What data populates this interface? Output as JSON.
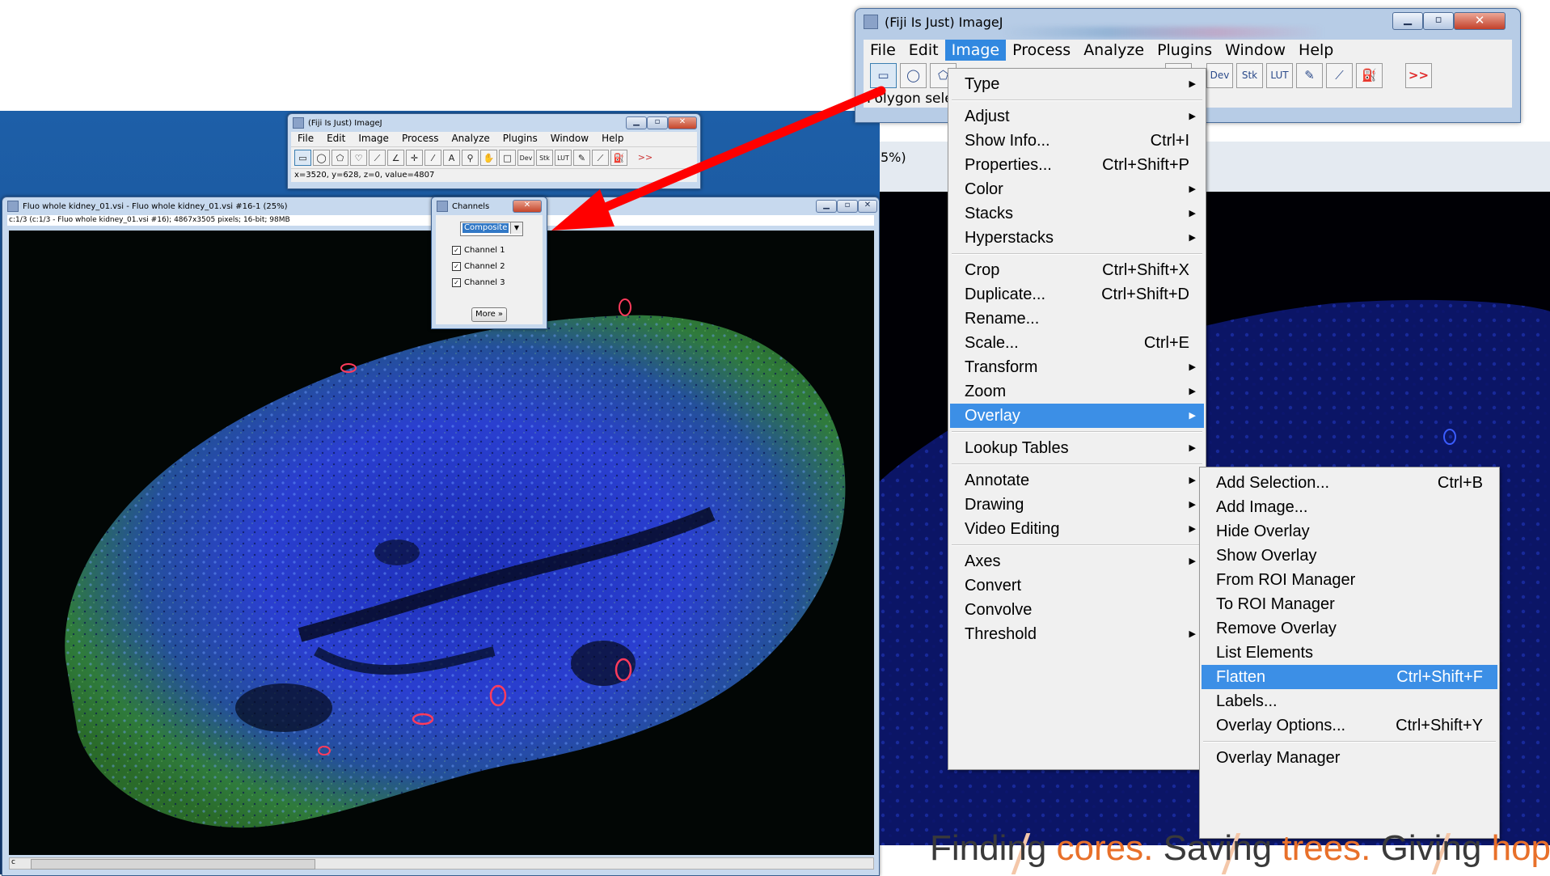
{
  "small_ij": {
    "title": "(Fiji Is Just) ImageJ",
    "menu": [
      "File",
      "Edit",
      "Image",
      "Process",
      "Analyze",
      "Plugins",
      "Window",
      "Help"
    ],
    "status": "x=3520, y=628, z=0, value=4807"
  },
  "image_window": {
    "title": "Fluo whole kidney_01.vsi - Fluo whole kidney_01.vsi #16-1 (25%)",
    "info": "c:1/3 (c:1/3 - Fluo whole kidney_01.vsi #16); 4867x3505 pixels; 16-bit; 98MB",
    "scroll_label": "c"
  },
  "channels": {
    "title": "Channels",
    "mode": "Composite",
    "items": [
      {
        "label": "Channel 1",
        "checked": true
      },
      {
        "label": "Channel 2",
        "checked": true
      },
      {
        "label": "Channel 3",
        "checked": true
      }
    ],
    "more_button": "More »"
  },
  "big_ij": {
    "title": "(Fiji Is Just) ImageJ",
    "menu": [
      "File",
      "Edit",
      "Image",
      "Process",
      "Analyze",
      "Plugins",
      "Window",
      "Help"
    ],
    "active_menu": "Image",
    "tools_right": [
      "Dev",
      "Stk",
      "LUT"
    ],
    "overflow": ">>",
    "status": "Polygon sele",
    "zoom_label": "5%)"
  },
  "image_menu": [
    {
      "label": "Type",
      "sub": true
    },
    {
      "sep": true
    },
    {
      "label": "Adjust",
      "sub": true
    },
    {
      "label": "Show Info...",
      "shortcut": "Ctrl+I"
    },
    {
      "label": "Properties...",
      "shortcut": "Ctrl+Shift+P"
    },
    {
      "label": "Color",
      "sub": true
    },
    {
      "label": "Stacks",
      "sub": true
    },
    {
      "label": "Hyperstacks",
      "sub": true
    },
    {
      "sep": true
    },
    {
      "label": "Crop",
      "shortcut": "Ctrl+Shift+X"
    },
    {
      "label": "Duplicate...",
      "shortcut": "Ctrl+Shift+D"
    },
    {
      "label": "Rename..."
    },
    {
      "label": "Scale...",
      "shortcut": "Ctrl+E"
    },
    {
      "label": "Transform",
      "sub": true
    },
    {
      "label": "Zoom",
      "sub": true
    },
    {
      "label": "Overlay",
      "sub": true,
      "highlight": true
    },
    {
      "sep": true
    },
    {
      "label": "Lookup Tables",
      "sub": true
    },
    {
      "sep": true
    },
    {
      "label": "Annotate",
      "sub": true
    },
    {
      "label": "Drawing",
      "sub": true
    },
    {
      "label": "Video Editing",
      "sub": true
    },
    {
      "sep": true
    },
    {
      "label": "Axes",
      "sub": true
    },
    {
      "label": "Convert"
    },
    {
      "label": "Convolve"
    },
    {
      "label": "Threshold",
      "sub": true
    }
  ],
  "overlay_menu": [
    {
      "label": "Add Selection...",
      "shortcut": "Ctrl+B"
    },
    {
      "label": "Add Image..."
    },
    {
      "label": "Hide Overlay"
    },
    {
      "label": "Show Overlay"
    },
    {
      "label": "From ROI Manager"
    },
    {
      "label": "To ROI Manager"
    },
    {
      "label": "Remove Overlay"
    },
    {
      "label": "List Elements"
    },
    {
      "label": "Flatten",
      "shortcut": "Ctrl+Shift+F",
      "highlight": true
    },
    {
      "label": "Labels..."
    },
    {
      "label": "Overlay Options...",
      "shortcut": "Ctrl+Shift+Y"
    },
    {
      "sep": true
    },
    {
      "label": "Overlay Manager"
    }
  ],
  "slide_text": {
    "a": "Finding ",
    "b": "cores. ",
    "c": "Saving ",
    "d": "trees. ",
    "e": "Giving ",
    "f": "hope."
  },
  "colors": {
    "highlight": "#3c8fe6",
    "arrow": "#ff0000",
    "slide_accent": "#e8702a"
  }
}
